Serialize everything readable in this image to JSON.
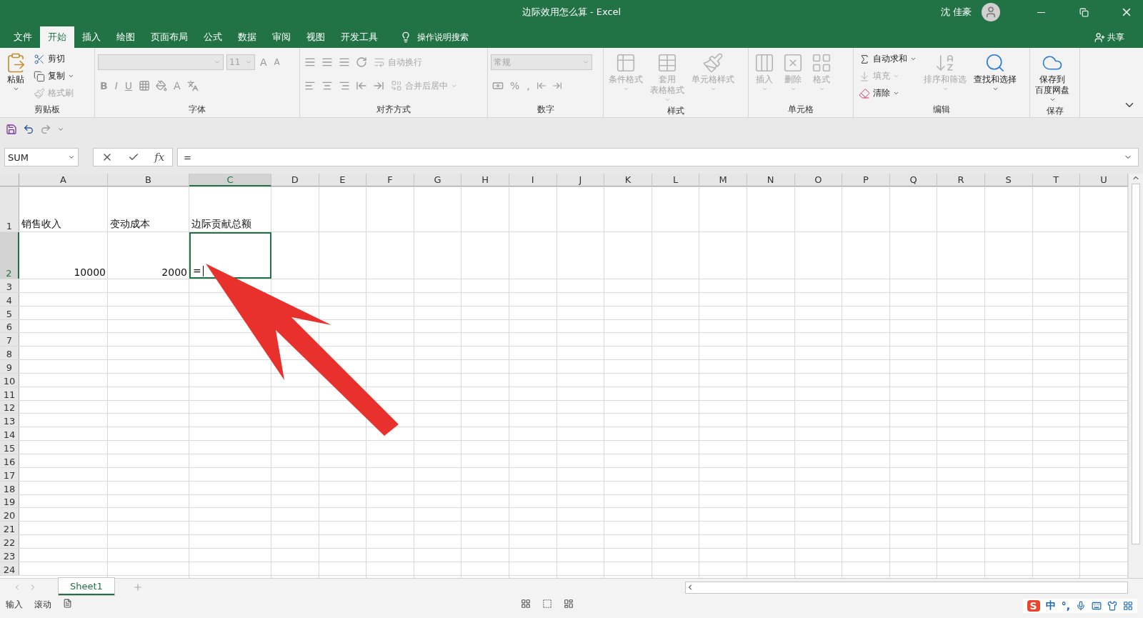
{
  "window": {
    "title": "边际效用怎么算  -  Excel",
    "user": "沈 佳豪"
  },
  "tabs": [
    {
      "label": "文件",
      "selected": false
    },
    {
      "label": "开始",
      "selected": true
    },
    {
      "label": "插入",
      "selected": false
    },
    {
      "label": "绘图",
      "selected": false
    },
    {
      "label": "页面布局",
      "selected": false
    },
    {
      "label": "公式",
      "selected": false
    },
    {
      "label": "数据",
      "selected": false
    },
    {
      "label": "审阅",
      "selected": false
    },
    {
      "label": "视图",
      "selected": false
    },
    {
      "label": "开发工具",
      "selected": false
    }
  ],
  "tell_me": "操作说明搜索",
  "share": "共享",
  "ribbon": [
    {
      "kind": "clipboard",
      "label": "剪贴板",
      "items": [
        {
          "lines": [
            "粘贴"
          ],
          "disabled": false
        },
        {
          "lines": [
            "剪切"
          ],
          "disabled": false
        },
        {
          "lines": [
            "复制"
          ],
          "disabled": false
        },
        {
          "lines": [
            "格式刷"
          ],
          "disabled": true
        }
      ]
    },
    {
      "kind": "font",
      "label": "字体",
      "font_size": "11",
      "grow": "A",
      "shrink": "A",
      "styles": [
        "B",
        "I",
        "U"
      ],
      "color_button": "A"
    },
    {
      "kind": "alignment",
      "label": "对齐方式",
      "items": [
        {
          "lines": [
            "自动换行"
          ],
          "disabled": true
        },
        {
          "lines": [
            "合并后居中"
          ],
          "disabled": true
        }
      ]
    },
    {
      "kind": "number",
      "label": "数字",
      "format": "常规",
      "symbols": [
        "%",
        ","
      ]
    },
    {
      "kind": "large",
      "label": "样式",
      "items": [
        {
          "lines": [
            "条件格式"
          ],
          "disabled": true
        },
        {
          "lines": [
            "套用",
            "表格格式"
          ],
          "disabled": true
        },
        {
          "lines": [
            "单元格样式"
          ],
          "disabled": true
        }
      ]
    },
    {
      "kind": "large",
      "label": "单元格",
      "items": [
        {
          "lines": [
            "插入"
          ],
          "disabled": true
        },
        {
          "lines": [
            "删除"
          ],
          "disabled": true
        },
        {
          "lines": [
            "格式"
          ],
          "disabled": true
        }
      ]
    },
    {
      "kind": "editing",
      "label": "编辑",
      "items": [
        {
          "lines": [
            "自动求和"
          ],
          "disabled": false
        },
        {
          "lines": [
            "填充"
          ],
          "disabled": true
        },
        {
          "lines": [
            "清除"
          ],
          "disabled": false
        },
        {
          "lines": [
            "排序和筛选"
          ],
          "disabled": true
        },
        {
          "lines": [
            "查找和选择"
          ],
          "disabled": false
        }
      ]
    },
    {
      "kind": "large",
      "label": "保存",
      "items": [
        {
          "lines": [
            "保存到",
            "百度网盘"
          ],
          "disabled": false
        }
      ]
    }
  ],
  "formula_bar": {
    "name_box": "SUM",
    "fx": "fx",
    "formula": "="
  },
  "sheet": {
    "columns": [
      {
        "label": "A",
        "selected": false
      },
      {
        "label": "B",
        "selected": false
      },
      {
        "label": "C",
        "selected": true
      },
      {
        "label": "D",
        "selected": false
      },
      {
        "label": "E",
        "selected": false
      },
      {
        "label": "F",
        "selected": false
      },
      {
        "label": "G",
        "selected": false
      },
      {
        "label": "H",
        "selected": false
      },
      {
        "label": "I",
        "selected": false
      },
      {
        "label": "J",
        "selected": false
      },
      {
        "label": "K",
        "selected": false
      },
      {
        "label": "L",
        "selected": false
      },
      {
        "label": "M",
        "selected": false
      },
      {
        "label": "N",
        "selected": false
      },
      {
        "label": "O",
        "selected": false
      },
      {
        "label": "P",
        "selected": false
      },
      {
        "label": "Q",
        "selected": false
      },
      {
        "label": "R",
        "selected": false
      },
      {
        "label": "S",
        "selected": false
      },
      {
        "label": "T",
        "selected": false
      },
      {
        "label": "U",
        "selected": false
      }
    ],
    "rows": [
      {
        "label": "1",
        "selected": false,
        "cells": [
          {
            "text": "销售收入",
            "kind": "text",
            "selected": false
          },
          {
            "text": "变动成本",
            "kind": "text",
            "selected": false
          },
          {
            "text": "边际贡献总额",
            "kind": "text",
            "selected": false
          }
        ]
      },
      {
        "label": "2",
        "selected": true,
        "cells": [
          {
            "text": "10000",
            "kind": "number",
            "selected": false
          },
          {
            "text": "2000",
            "kind": "number",
            "selected": false
          },
          {
            "text": "=",
            "kind": "text",
            "selected": true
          }
        ]
      },
      {
        "label": "3",
        "selected": false
      },
      {
        "label": "4",
        "selected": false
      },
      {
        "label": "5",
        "selected": false
      },
      {
        "label": "6",
        "selected": false
      },
      {
        "label": "7",
        "selected": false
      },
      {
        "label": "8",
        "selected": false
      },
      {
        "label": "9",
        "selected": false
      },
      {
        "label": "10",
        "selected": false
      },
      {
        "label": "11",
        "selected": false
      },
      {
        "label": "12",
        "selected": false
      },
      {
        "label": "13",
        "selected": false
      },
      {
        "label": "14",
        "selected": false
      },
      {
        "label": "15",
        "selected": false
      },
      {
        "label": "16",
        "selected": false
      },
      {
        "label": "17",
        "selected": false
      },
      {
        "label": "18",
        "selected": false
      },
      {
        "label": "19",
        "selected": false
      },
      {
        "label": "20",
        "selected": false
      },
      {
        "label": "21",
        "selected": false
      },
      {
        "label": "22",
        "selected": false
      },
      {
        "label": "23",
        "selected": false
      },
      {
        "label": "24",
        "selected": false
      }
    ]
  },
  "sheet_tabs": [
    {
      "label": "Sheet1",
      "selected": true
    }
  ],
  "status_bar": {
    "mode": "输入",
    "scroll": "滚动"
  },
  "ime": {
    "logo": "S",
    "lang": "中",
    "punct": "°,"
  }
}
